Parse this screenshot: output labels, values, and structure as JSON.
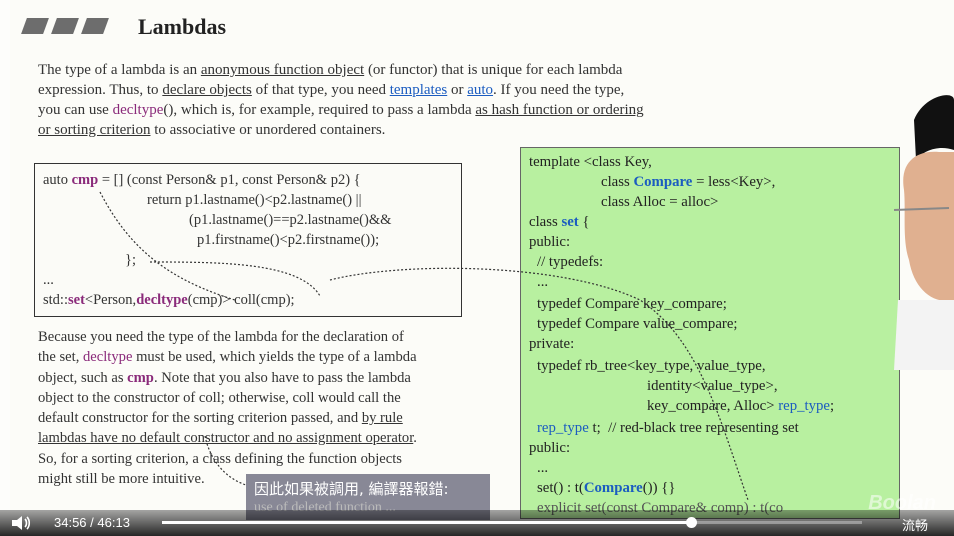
{
  "slide": {
    "title": "Lambdas",
    "intro": {
      "l1a": "The type of a lambda is an ",
      "l1u": "anonymous function object",
      "l1b": " (or functor) that is unique for each lambda",
      "l2a": "expression. Thus, to ",
      "l2u": "declare objects",
      "l2b": " of that type, you need ",
      "l2link1": "templates",
      "l2c": " or ",
      "l2link2": "auto",
      "l2d": ". If you need the type,",
      "l3a": "you can use ",
      "l3kw": "decltype",
      "l3b": "(), which is, for example, required to pass a lambda ",
      "l3u": "as hash function or ordering",
      "l4u": "or sorting criterion",
      "l4b": " to associative or unordered containers."
    },
    "code": {
      "l1a": "auto ",
      "l1b": "cmp",
      "l1c": " = [] (const Person& p1, const Person& p2) {",
      "l2": "return p1.lastname()<p2.lastname() ||",
      "l3": "(p1.lastname()==p2.lastname()&&",
      "l4": "p1.firstname()<p2.firstname());",
      "l5": "};",
      "l6": "...",
      "l7a": "std::",
      "l7b": "set",
      "l7c": "<Person,",
      "l7d": "decltype",
      "l7e": "(cmp)> coll(cmp);"
    },
    "para2": {
      "l1": "Because you need the type of the lambda for the declaration of",
      "l2a": "the set, ",
      "l2kw": "decltype",
      "l2b": " must be used, which yields the type of a lambda",
      "l3a": "object, such as ",
      "l3b": "cmp",
      "l3c": ". Note that you also have to pass the lambda",
      "l4": "object to the constructor of coll; otherwise, coll would call the",
      "l5a": "default constructor for the sorting criterion passed, and ",
      "l5u": "by rule",
      "l6u": "lambdas have no default constructor and no assignment operator",
      "l6b": ".",
      "l7": "So, for a sorting criterion, a class defining the function objects",
      "l8": "might still be more intuitive."
    },
    "green": {
      "l1": "template <class Key,",
      "l2a": "class ",
      "l2b": "Compare",
      "l2c": " = less<Key>,",
      "l3": "class Alloc = alloc>",
      "l4a": "class ",
      "l4b": "set",
      "l4c": " {",
      "l5": "public:",
      "l6": "// typedefs:",
      "l7": "...",
      "l8": "typedef Compare key_compare;",
      "l9": "typedef Compare value_compare;",
      "l10": "private:",
      "l11": "typedef rb_tree<key_type, value_type,",
      "l12": "identity<value_type>,",
      "l13a": "key_compare, Alloc> ",
      "l13b": "rep_type",
      "l13c": ";",
      "l14a": "rep_type",
      "l14b": " t;  // red-black tree representing set",
      "l15": "public:",
      "l16": "...",
      "l17a": "set() : t(",
      "l17b": "Compare",
      "l17c": "()) {}",
      "l18": "explicit set(const Compare& comp) : t(co"
    }
  },
  "subtitle": {
    "main": "因此如果被調用, 編譯器報錯:",
    "ghost": "use of deleted function ..."
  },
  "player": {
    "current_time": "34:56",
    "separator": "/",
    "total_time": "46:13",
    "progress_fraction": 0.756,
    "quality_label": "流畅",
    "watermark": "Boolan",
    "volume_icon": "speaker-icon"
  },
  "colors": {
    "code_green": "#b8f0a0",
    "keyword_purple": "#8a2a7a",
    "keyword_blue": "#1b5cc0"
  }
}
